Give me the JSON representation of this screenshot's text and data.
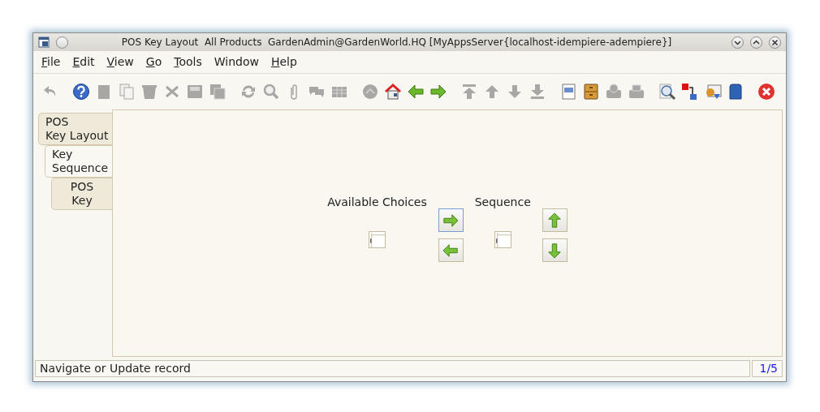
{
  "window": {
    "title": "POS Key Layout  All Products  GardenAdmin@GardenWorld.HQ [MyAppsServer{localhost-idempiere-adempiere}]"
  },
  "menu": [
    {
      "label": "File",
      "underline_first": true
    },
    {
      "label": "Edit",
      "underline_first": true
    },
    {
      "label": "View",
      "underline_first": true
    },
    {
      "label": "Go",
      "underline_first": true
    },
    {
      "label": "Tools",
      "underline_first": true
    },
    {
      "label": "Window",
      "underline_first": false
    },
    {
      "label": "Help",
      "underline_first": true
    }
  ],
  "toolbar": [
    [
      {
        "kind": "undo",
        "disabled": true
      }
    ],
    [
      {
        "kind": "help",
        "disabled": false
      },
      {
        "kind": "new",
        "disabled": true
      },
      {
        "kind": "copy",
        "disabled": true
      },
      {
        "kind": "delete",
        "disabled": true
      },
      {
        "kind": "delete-selection",
        "disabled": true
      },
      {
        "kind": "save",
        "disabled": true
      },
      {
        "kind": "save-all",
        "disabled": true
      }
    ],
    [
      {
        "kind": "refresh",
        "disabled": true
      },
      {
        "kind": "find",
        "disabled": true
      },
      {
        "kind": "attach",
        "disabled": true
      },
      {
        "kind": "chat",
        "disabled": true
      },
      {
        "kind": "grid",
        "disabled": true
      }
    ],
    [
      {
        "kind": "history",
        "disabled": true
      },
      {
        "kind": "home",
        "disabled": false
      },
      {
        "kind": "back",
        "disabled": false
      },
      {
        "kind": "forward",
        "disabled": false
      }
    ],
    [
      {
        "kind": "first",
        "disabled": true
      },
      {
        "kind": "prev",
        "disabled": true
      },
      {
        "kind": "next",
        "disabled": true
      },
      {
        "kind": "last",
        "disabled": true
      }
    ],
    [
      {
        "kind": "report",
        "disabled": false
      },
      {
        "kind": "archive",
        "disabled": false
      },
      {
        "kind": "print-preview",
        "disabled": true
      },
      {
        "kind": "print",
        "disabled": true
      }
    ],
    [
      {
        "kind": "zoom-across",
        "disabled": false
      },
      {
        "kind": "request",
        "disabled": false
      },
      {
        "kind": "workflow",
        "disabled": false
      },
      {
        "kind": "product-info",
        "disabled": false
      }
    ],
    [
      {
        "kind": "close",
        "disabled": false
      }
    ]
  ],
  "tabs": [
    {
      "label": "POS\nKey Layout",
      "selected": false,
      "children": [
        {
          "label": "Key\nSequence",
          "selected": true,
          "children": [
            {
              "label": "POS\nKey",
              "selected": false
            }
          ]
        }
      ]
    }
  ],
  "sort_panel": {
    "available_label": "Available Choices",
    "sequence_label": "Sequence",
    "move_buttons": [
      {
        "kind": "right",
        "focused": true
      },
      {
        "kind": "left",
        "focused": false
      }
    ],
    "order_buttons": [
      {
        "kind": "up",
        "focused": false
      },
      {
        "kind": "down",
        "focused": false
      }
    ]
  },
  "status_bar": {
    "message": "Navigate or Update record",
    "record": "1/5"
  }
}
